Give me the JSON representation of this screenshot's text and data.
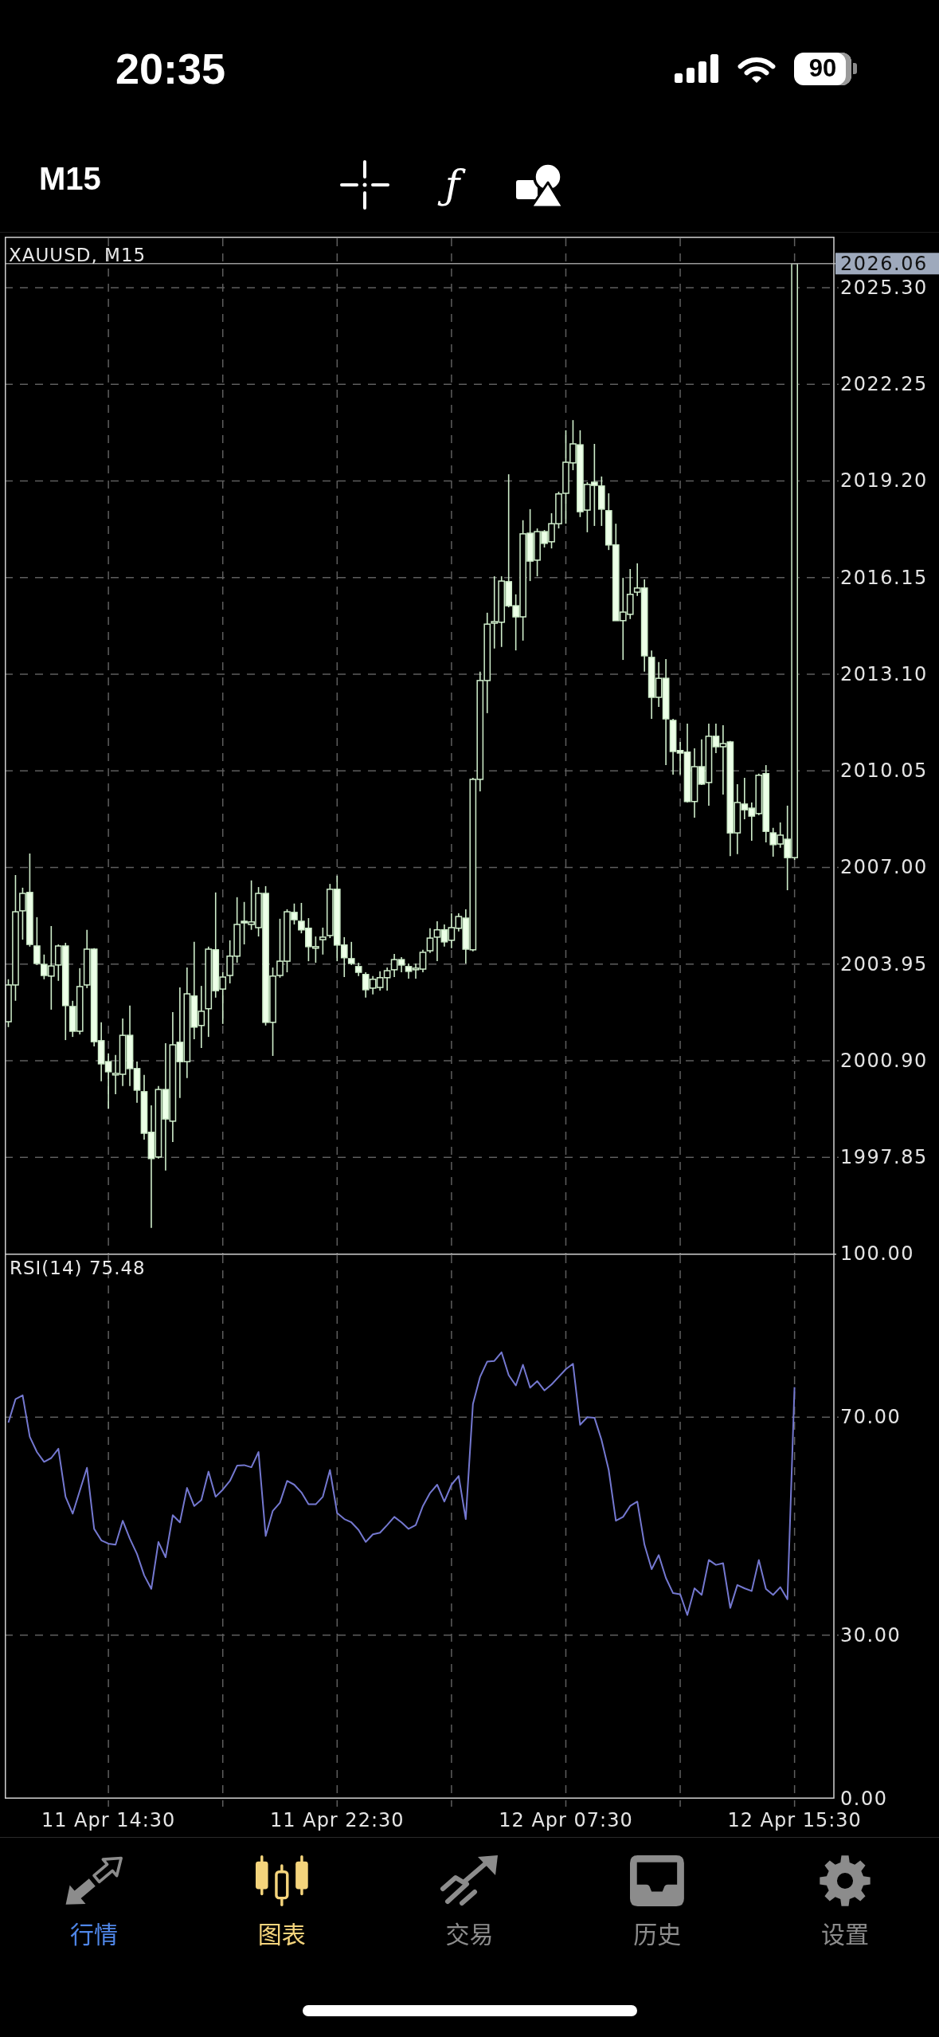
{
  "status_bar": {
    "time": "20:35",
    "battery": "90"
  },
  "toolbar": {
    "timeframe": "M15",
    "tools": [
      {
        "kind": "crosshair"
      },
      {
        "kind": "function",
        "symbol": "ƒ"
      },
      {
        "kind": "objects"
      }
    ]
  },
  "chart": {
    "chart_data": {
      "type": "candlestick",
      "title": "XAUUSD, M15",
      "grid": true,
      "categories": [
        null,
        null,
        null,
        null,
        null,
        null,
        null,
        null,
        null,
        null,
        null,
        null,
        null,
        null,
        null,
        null,
        null,
        null,
        null,
        null,
        null,
        null,
        null,
        null,
        null,
        null,
        null,
        null,
        null,
        null,
        null,
        null,
        null,
        null,
        null,
        null,
        null,
        null,
        null,
        null,
        null,
        null,
        null,
        null,
        null,
        null,
        null,
        null,
        null,
        null,
        null,
        null,
        null,
        null,
        null,
        null,
        null,
        null,
        null,
        null,
        null,
        null,
        null,
        null,
        null,
        null,
        null,
        null,
        null,
        null,
        null,
        null,
        null,
        null,
        null,
        null,
        null,
        null,
        null,
        null,
        null,
        null,
        null,
        null,
        null,
        null,
        null,
        null,
        null,
        null,
        null,
        null,
        null,
        null,
        null,
        null,
        null,
        null,
        null,
        null,
        null,
        null,
        null,
        null,
        null,
        null,
        null,
        null,
        null,
        null,
        null,
        null,
        null,
        null,
        null,
        null
      ],
      "ylim": [
        1994.81,
        2026.91
      ],
      "yticks": [
        {
          "value": 2025.3,
          "label": "2025.30"
        },
        {
          "value": 2022.25,
          "label": "2022.25"
        },
        {
          "value": 2019.2,
          "label": "2019.20"
        },
        {
          "value": 2016.15,
          "label": "2016.15"
        },
        {
          "value": 2013.1,
          "label": "2013.10"
        },
        {
          "value": 2010.05,
          "label": "2010.05"
        },
        {
          "value": 2007,
          "label": "2007.00"
        },
        {
          "value": 2003.95,
          "label": "2003.95"
        },
        {
          "value": 2000.9,
          "label": "2000.90"
        },
        {
          "value": 1997.85,
          "label": "1997.85"
        }
      ],
      "ref_lines": [
        {
          "axis": "y",
          "value": 2026.06,
          "label": "2026.06"
        }
      ],
      "ohlc": [
        [
          2002.13,
          2003.47,
          2001.96,
          2003.29
        ],
        [
          2003.29,
          2006.76,
          2002.79,
          2005.6
        ],
        [
          2005.63,
          2006.36,
          2004.72,
          2006.18
        ],
        [
          2006.21,
          2007.44,
          2004.5,
          2004.57
        ],
        [
          2004.52,
          2005.43,
          2003.92,
          2003.97
        ],
        [
          2003.94,
          2004.25,
          2003.47,
          2003.59
        ],
        [
          2003.57,
          2005.15,
          2002.51,
          2003.89
        ],
        [
          2003.92,
          2004.57,
          2003.42,
          2004.52
        ],
        [
          2004.52,
          2004.62,
          2001.55,
          2002.64
        ],
        [
          2002.61,
          2002.79,
          2001.65,
          2001.83
        ],
        [
          2001.83,
          2003.82,
          2001.73,
          2003.24
        ],
        [
          2003.29,
          2005.03,
          2003.19,
          2004.42
        ],
        [
          2004.42,
          2004.45,
          2001.35,
          2001.5
        ],
        [
          2001.53,
          2002.11,
          2000.25,
          2000.8
        ],
        [
          2000.87,
          2001.13,
          1999.39,
          2000.55
        ],
        [
          2000.45,
          2001.08,
          1999.84,
          2000.5
        ],
        [
          2000.47,
          2002.23,
          2000.1,
          2001.7
        ],
        [
          2001.7,
          2002.64,
          2000.1,
          2000.65
        ],
        [
          2000.65,
          2000.87,
          1999.57,
          1999.97
        ],
        [
          1999.92,
          2000.45,
          1998.41,
          1998.61
        ],
        [
          1998.64,
          1999.49,
          1995.62,
          1997.81
        ],
        [
          1997.86,
          2000.1,
          1997.81,
          1999.99
        ],
        [
          1999.99,
          2001.45,
          1997.43,
          1999.06
        ],
        [
          1998.99,
          2002.43,
          1998.33,
          2001.4
        ],
        [
          2001.48,
          2003.21,
          1999.72,
          2000.87
        ],
        [
          2000.87,
          2003.84,
          2000.35,
          2003.01
        ],
        [
          2002.94,
          2004.65,
          2001.58,
          2001.96
        ],
        [
          2002.01,
          2003.26,
          2001.3,
          2002.46
        ],
        [
          2002.54,
          2004.5,
          2001.65,
          2004.42
        ],
        [
          2004.4,
          2006.21,
          2002.89,
          2003.11
        ],
        [
          2003.16,
          2003.69,
          2002.06,
          2003.54
        ],
        [
          2003.59,
          2004.7,
          2003.34,
          2004.2
        ],
        [
          2004.2,
          2006.06,
          2003.99,
          2005.2
        ],
        [
          2005.3,
          2005.91,
          2004.57,
          2005.25
        ],
        [
          2005.2,
          2006.59,
          2005.03,
          2005.28
        ],
        [
          2005.1,
          2006.38,
          2004.82,
          2006.18
        ],
        [
          2006.18,
          2006.41,
          2002.01,
          2002.11
        ],
        [
          2002.11,
          2003.84,
          2001.05,
          2003.57
        ],
        [
          2003.59,
          2005.38,
          2003.52,
          2004.04
        ],
        [
          2004.04,
          2005.68,
          2003.69,
          2005.6
        ],
        [
          2005.58,
          2005.86,
          2005.2,
          2005.35
        ],
        [
          2005.3,
          2005.88,
          2004.92,
          2005.03
        ],
        [
          2005.08,
          2005.4,
          2004.04,
          2004.5
        ],
        [
          2004.45,
          2004.82,
          2003.99,
          2004.5
        ],
        [
          2004.72,
          2005.1,
          2004.25,
          2004.8
        ],
        [
          2004.85,
          2006.48,
          2004.77,
          2006.31
        ],
        [
          2006.31,
          2006.74,
          2004.04,
          2004.55
        ],
        [
          2004.55,
          2004.8,
          2003.54,
          2004.15
        ],
        [
          2004.12,
          2004.65,
          2003.92,
          2003.97
        ],
        [
          2003.87,
          2003.99,
          2003.57,
          2003.69
        ],
        [
          2003.62,
          2003.69,
          2002.89,
          2003.14
        ],
        [
          2003.19,
          2003.57,
          2002.99,
          2003.47
        ],
        [
          2003.21,
          2003.72,
          2003.11,
          2003.52
        ],
        [
          2003.52,
          2003.84,
          2003.11,
          2003.74
        ],
        [
          2003.77,
          2004.27,
          2003.54,
          2004.09
        ],
        [
          2004.09,
          2004.17,
          2003.69,
          2003.92
        ],
        [
          2003.87,
          2003.97,
          2003.49,
          2003.72
        ],
        [
          2003.77,
          2003.97,
          2003.49,
          2003.82
        ],
        [
          2003.79,
          2004.4,
          2003.69,
          2004.32
        ],
        [
          2004.37,
          2005.08,
          2004.3,
          2004.77
        ],
        [
          2004.8,
          2005.3,
          2004.04,
          2005.03
        ],
        [
          2005.03,
          2005.2,
          2004.5,
          2004.65
        ],
        [
          2004.7,
          2005.55,
          2004.45,
          2005.1
        ],
        [
          2005.08,
          2005.55,
          2004.98,
          2005.45
        ],
        [
          2005.4,
          2005.68,
          2003.97,
          2004.42
        ],
        [
          2004.4,
          2009.83,
          2004.35,
          2009.78
        ],
        [
          2009.78,
          2013.18,
          2009.4,
          2012.9
        ],
        [
          2012.9,
          2015.04,
          2011.87,
          2014.68
        ],
        [
          2014.71,
          2016.19,
          2013.91,
          2014.76
        ],
        [
          2014.74,
          2016.19,
          2013.96,
          2016.04
        ],
        [
          2016.02,
          2019.41,
          2015.21,
          2015.26
        ],
        [
          2015.26,
          2015.62,
          2013.85,
          2014.91
        ],
        [
          2014.91,
          2017.96,
          2014.16,
          2017.53
        ],
        [
          2017.55,
          2018.31,
          2016.04,
          2016.67
        ],
        [
          2016.7,
          2017.7,
          2016.19,
          2017.6
        ],
        [
          2017.6,
          2017.65,
          2017.1,
          2017.23
        ],
        [
          2017.28,
          2018.18,
          2017.07,
          2017.85
        ],
        [
          2017.85,
          2018.86,
          2017.7,
          2018.79
        ],
        [
          2018.81,
          2020.8,
          2017.85,
          2019.79
        ],
        [
          2019.77,
          2021.12,
          2019.54,
          2020.37
        ],
        [
          2020.34,
          2020.8,
          2018.06,
          2018.23
        ],
        [
          2018.28,
          2019.16,
          2017.58,
          2019.09
        ],
        [
          2019.16,
          2020.37,
          2017.78,
          2019.06
        ],
        [
          2019.04,
          2019.34,
          2017.78,
          2018.31
        ],
        [
          2018.26,
          2018.81,
          2017.02,
          2017.18
        ],
        [
          2017.18,
          2017.85,
          2014.79,
          2014.79
        ],
        [
          2014.79,
          2016.14,
          2013.55,
          2015.06
        ],
        [
          2014.99,
          2016.42,
          2014.84,
          2015.62
        ],
        [
          2015.69,
          2016.6,
          2015.57,
          2015.82
        ],
        [
          2015.82,
          2016.09,
          2013.18,
          2013.68
        ],
        [
          2013.63,
          2013.85,
          2011.69,
          2012.37
        ],
        [
          2012.37,
          2013.48,
          2012.07,
          2012.97
        ],
        [
          2012.97,
          2013.58,
          2010.23,
          2011.69
        ],
        [
          2011.64,
          2011.69,
          2009.93,
          2010.66
        ],
        [
          2010.69,
          2010.96,
          2009.93,
          2010.61
        ],
        [
          2010.64,
          2011.54,
          2009.05,
          2009.08
        ],
        [
          2009.08,
          2010.76,
          2008.57,
          2010.18
        ],
        [
          2010.18,
          2011.04,
          2009.6,
          2009.63
        ],
        [
          2009.68,
          2011.54,
          2008.95,
          2011.14
        ],
        [
          2011.14,
          2011.54,
          2010.61,
          2010.81
        ],
        [
          2010.81,
          2011.49,
          2009.3,
          2010.91
        ],
        [
          2010.96,
          2010.99,
          2007.36,
          2008.09
        ],
        [
          2008.09,
          2009.63,
          2007.42,
          2009.05
        ],
        [
          2009.0,
          2009.83,
          2008.52,
          2008.82
        ],
        [
          2008.87,
          2009.05,
          2007.84,
          2008.62
        ],
        [
          2008.7,
          2009.96,
          2008.65,
          2009.91
        ],
        [
          2009.96,
          2010.23,
          2007.79,
          2008.14
        ],
        [
          2008.09,
          2008.25,
          2007.34,
          2007.72
        ],
        [
          2007.74,
          2008.42,
          2007.62,
          2008.02
        ],
        [
          2007.89,
          2008.95,
          2006.28,
          2007.31
        ],
        [
          2007.31,
          2026.06,
          2007.24,
          2026.06
        ],
        null,
        null,
        null,
        null,
        null
      ]
    }
  },
  "rsi": {
    "chart_data": {
      "type": "line",
      "title": "RSI(14) 75.48",
      "grid": true,
      "categories": [
        null,
        null,
        null,
        null,
        null,
        null,
        null,
        null,
        null,
        null,
        null,
        null,
        null,
        null,
        "11 Apr 14:30",
        null,
        null,
        null,
        null,
        null,
        null,
        null,
        null,
        null,
        null,
        null,
        null,
        null,
        null,
        null,
        null,
        null,
        null,
        null,
        null,
        null,
        null,
        null,
        null,
        null,
        null,
        null,
        null,
        null,
        null,
        null,
        "11 Apr 22:30",
        null,
        null,
        null,
        null,
        null,
        null,
        null,
        null,
        null,
        null,
        null,
        null,
        null,
        null,
        null,
        null,
        null,
        null,
        null,
        null,
        null,
        null,
        null,
        null,
        null,
        null,
        null,
        null,
        null,
        null,
        null,
        "12 Apr 07:30",
        null,
        null,
        null,
        null,
        null,
        null,
        null,
        null,
        null,
        null,
        null,
        null,
        null,
        null,
        null,
        null,
        null,
        null,
        null,
        null,
        null,
        null,
        null,
        null,
        null,
        null,
        null,
        null,
        null,
        null,
        null,
        "12 Apr 15:30",
        null,
        null,
        null,
        null,
        null
      ],
      "ylim": [
        0,
        100
      ],
      "yticks": [
        {
          "value": 100,
          "label": "100.00"
        },
        {
          "value": 70,
          "label": "70.00"
        },
        {
          "value": 30,
          "label": "30.00"
        },
        {
          "value": 0,
          "label": "0.00"
        }
      ],
      "series": [
        {
          "color": "#7478d0",
          "values": [
            69,
            73.3,
            74,
            66.4,
            63.6,
            61.8,
            62.5,
            64.2,
            55.4,
            52.3,
            56.5,
            60.7,
            49.5,
            47.4,
            46.8,
            46.6,
            51,
            47.7,
            44.9,
            41,
            38.5,
            47.1,
            44.3,
            52,
            50.7,
            57,
            53.7,
            54.8,
            60,
            55.4,
            56.7,
            58.3,
            61.1,
            61.2,
            60.8,
            63.6,
            48.2,
            52.8,
            54.3,
            58.3,
            57.6,
            56.2,
            54,
            54,
            55.4,
            60.3,
            52.4,
            51.3,
            50.7,
            49.3,
            47.1,
            48.5,
            48.8,
            50.2,
            51.7,
            50.7,
            49.5,
            50.2,
            53.7,
            56.1,
            57.6,
            54.5,
            57.6,
            59.2,
            51.3,
            72.4,
            77.4,
            80.2,
            80.3,
            81.9,
            77.7,
            75.8,
            79.6,
            75.4,
            76.6,
            74.9,
            76,
            77.4,
            78.8,
            79.8,
            68.6,
            70,
            69.9,
            65.8,
            60.3,
            51,
            51.7,
            53.7,
            54.5,
            46.6,
            42.1,
            44.7,
            40.5,
            37.7,
            37.5,
            33.7,
            38.6,
            37.4,
            43.8,
            42.9,
            43.2,
            35,
            39.2,
            38.6,
            38.1,
            43.8,
            38.5,
            37.4,
            38.8,
            36.6,
            75.5,
            null,
            null,
            null,
            null,
            null
          ]
        }
      ]
    }
  },
  "tabs": [
    {
      "kind": "quotes",
      "label": "行情",
      "selected": false,
      "color": "#4f86e8"
    },
    {
      "kind": "chart",
      "label": "图表",
      "selected": true,
      "color": "#f4d47c"
    },
    {
      "kind": "trade",
      "label": "交易",
      "selected": false,
      "color": "#8c8c8c"
    },
    {
      "kind": "history",
      "label": "历史",
      "selected": false,
      "color": "#8c8c8c"
    },
    {
      "kind": "settings",
      "label": "设置",
      "selected": false,
      "color": "#8c8c8c"
    }
  ]
}
